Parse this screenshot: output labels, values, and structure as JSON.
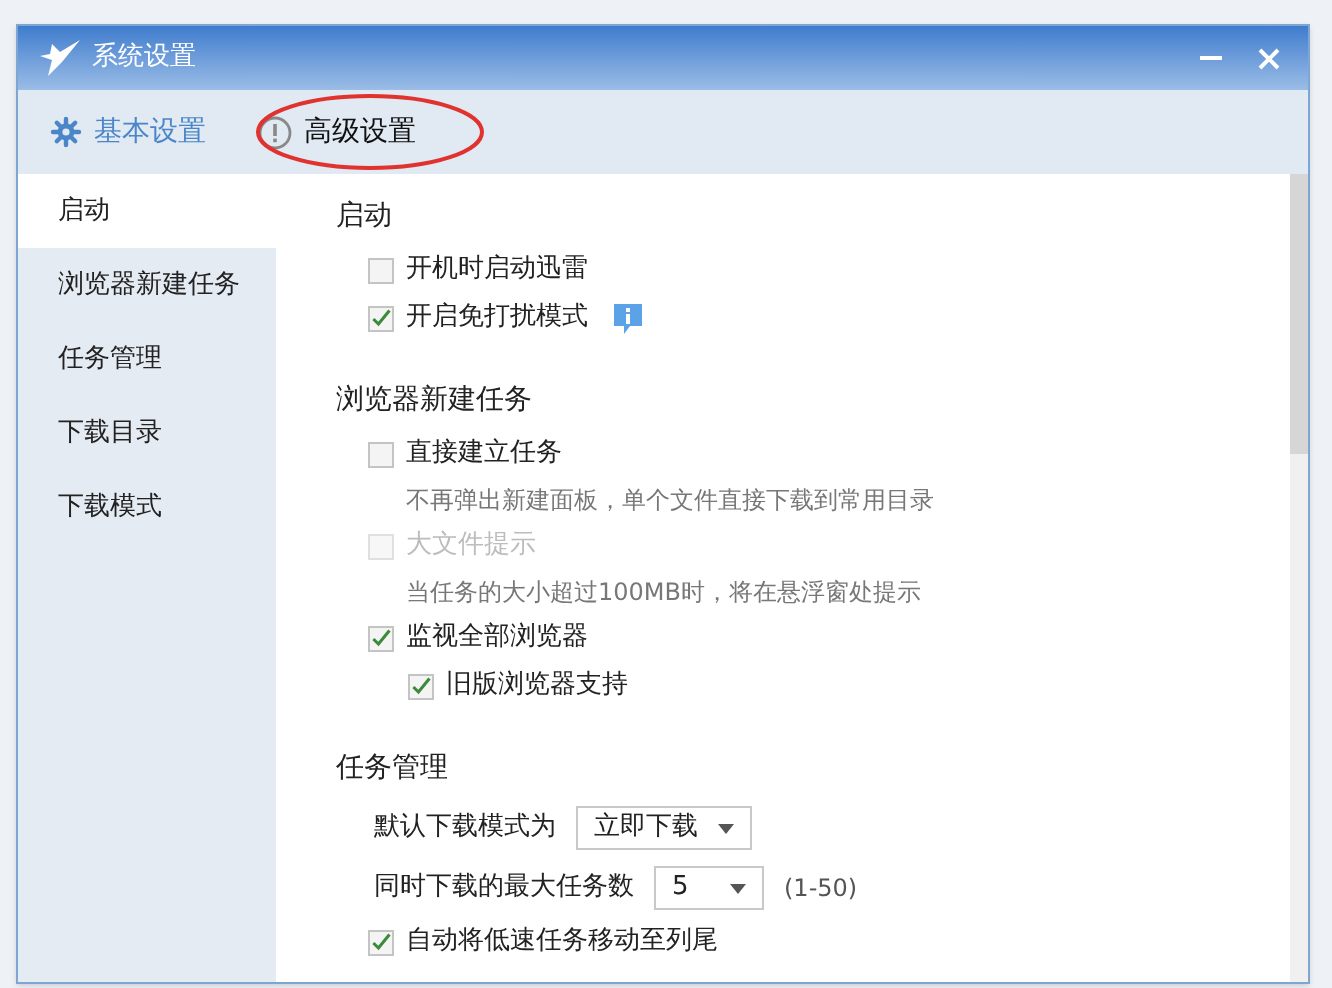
{
  "window": {
    "title": "系统设置"
  },
  "tabs": [
    {
      "label": "基本设置",
      "kind": "gear",
      "selected": false
    },
    {
      "label": "高级设置",
      "kind": "alert",
      "selected": true
    }
  ],
  "sidebar": {
    "items": [
      {
        "label": "启动",
        "selected": true
      },
      {
        "label": "浏览器新建任务",
        "selected": false
      },
      {
        "label": "任务管理",
        "selected": false
      },
      {
        "label": "下载目录",
        "selected": false
      },
      {
        "label": "下载模式",
        "selected": false
      }
    ]
  },
  "sections": [
    {
      "title": "启动",
      "items": [
        {
          "kind": "checkbox",
          "label": "开机时启动迅雷",
          "checked": false,
          "disabled": false
        },
        {
          "kind": "checkbox",
          "label": "开启免打扰模式",
          "checked": true,
          "disabled": false,
          "info": true
        }
      ]
    },
    {
      "title": "浏览器新建任务",
      "items": [
        {
          "kind": "checkbox",
          "label": "直接建立任务",
          "checked": false,
          "disabled": false,
          "description": "不再弹出新建面板，单个文件直接下载到常用目录"
        },
        {
          "kind": "checkbox",
          "label": "大文件提示",
          "checked": false,
          "disabled": true,
          "description": "当任务的大小超过100MB时，将在悬浮窗处提示"
        },
        {
          "kind": "checkbox",
          "label": "监视全部浏览器",
          "checked": true,
          "disabled": false,
          "children": [
            {
              "kind": "checkbox",
              "label": "旧版浏览器支持",
              "checked": true,
              "disabled": false
            }
          ]
        }
      ]
    },
    {
      "title": "任务管理",
      "items": [
        {
          "kind": "dropdown",
          "label": "默认下载模式为",
          "value": "立即下载"
        },
        {
          "kind": "dropdown",
          "label": "同时下载的最大任务数",
          "value": "5",
          "hint": "(1-50)"
        },
        {
          "kind": "checkbox",
          "label": "自动将低速任务移动至列尾",
          "checked": true,
          "disabled": false
        }
      ]
    }
  ]
}
